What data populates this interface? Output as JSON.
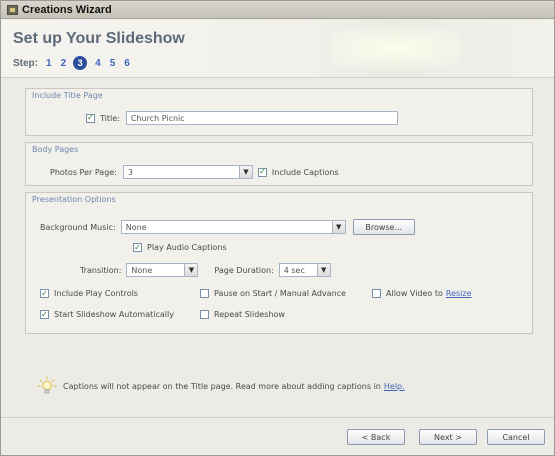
{
  "window": {
    "title": "Creations Wizard",
    "icon": "app-icon"
  },
  "header": {
    "heading": "Set up Your Slideshow",
    "step_label": "Step:",
    "steps": [
      "1",
      "2",
      "3",
      "4",
      "5",
      "6"
    ],
    "current_step": "3"
  },
  "title_page": {
    "section_label": "Include Title Page",
    "include_checked": true,
    "title_label": "Title:",
    "title_value": "Church Picnic"
  },
  "body_pages": {
    "section_label": "Body Pages",
    "photos_label": "Photos Per Page:",
    "photos_value": "3",
    "captions_checked": true,
    "captions_label": "Include Captions"
  },
  "presentation": {
    "section_label": "Presentation Options",
    "music_label": "Background Music:",
    "music_value": "None",
    "browse_label": "Browse...",
    "audio_captions_checked": true,
    "audio_captions_label": "Play Audio Captions",
    "transition_label": "Transition:",
    "transition_value": "None",
    "duration_label": "Page Duration:",
    "duration_value": "4 sec",
    "play_controls_checked": true,
    "play_controls_label": "Include Play Controls",
    "pause_checked": false,
    "pause_label": "Pause on Start / Manual Advance",
    "allow_video_checked": false,
    "allow_video_label": "Allow Video to",
    "resize_link": "Resize",
    "autostart_checked": true,
    "autostart_label": "Start Slideshow Automatically",
    "repeat_checked": false,
    "repeat_label": "Repeat Slideshow"
  },
  "tip": {
    "text": "Captions will not appear on the Title page. Read more about adding captions in",
    "help_link": "Help."
  },
  "footer": {
    "back_label": "< Back",
    "next_label": "Next >",
    "cancel_label": "Cancel"
  }
}
